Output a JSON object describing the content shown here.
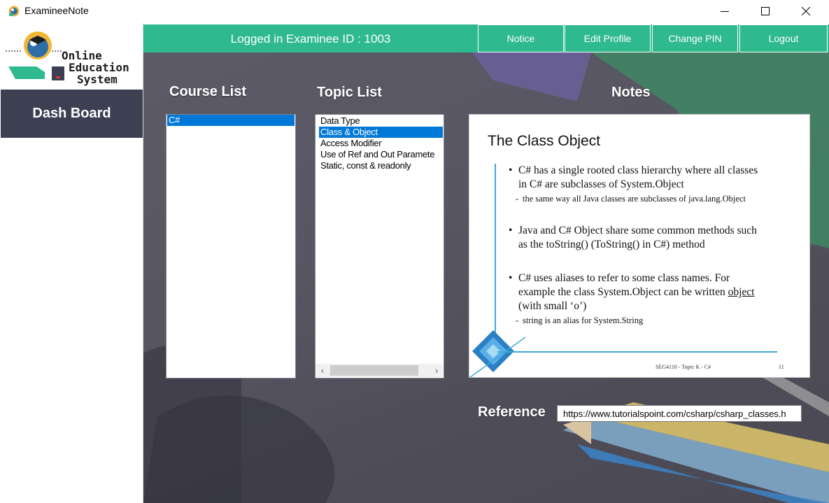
{
  "window": {
    "title": "ExamineeNote",
    "controls": [
      "minimize",
      "maximize",
      "close"
    ]
  },
  "sidebar": {
    "logo": {
      "line1": "Online",
      "line2": "Education",
      "line3": "System"
    },
    "dashboard_label": "Dash Board"
  },
  "topbar": {
    "login_text": "Logged in Examinee ID : 1003",
    "buttons": {
      "notice": "Notice",
      "edit_profile": "Edit Profile",
      "change_pin": "Change PIN",
      "logout": "Logout"
    },
    "color": "#2fb98e"
  },
  "course_list": {
    "heading": "Course List",
    "items": [
      "C#"
    ],
    "selected_index": 0
  },
  "topic_list": {
    "heading": "Topic List",
    "items": [
      "Data Type",
      "Class & Object",
      "Access Modifier",
      "Use of Ref and Out Paramete",
      "Static, const & readonly"
    ],
    "selected_index": 1
  },
  "notes": {
    "heading": "Notes",
    "slide": {
      "title": "The Class Object",
      "bullets": [
        {
          "text": "C# has a single rooted class hierarchy where all classes in C# are subclasses of System.Object",
          "sub": "the same way all Java classes are subclasses of java.lang.Object"
        },
        {
          "text": "Java and C# Object share some common methods such as the toString() (ToString() in C#) method",
          "sub": ""
        },
        {
          "text_before": "C# uses aliases to refer to some class names. For example the class System.Object can be written ",
          "text_underlined": "object",
          "text_after": " (with small ‘o’)",
          "sub": "string is an alias for System.String"
        }
      ],
      "footer": "SEG4110 - Topic K - C#",
      "page_number": "11"
    }
  },
  "reference": {
    "label": "Reference",
    "value": "https://www.tutorialspoint.com/csharp/csharp_classes.h"
  }
}
